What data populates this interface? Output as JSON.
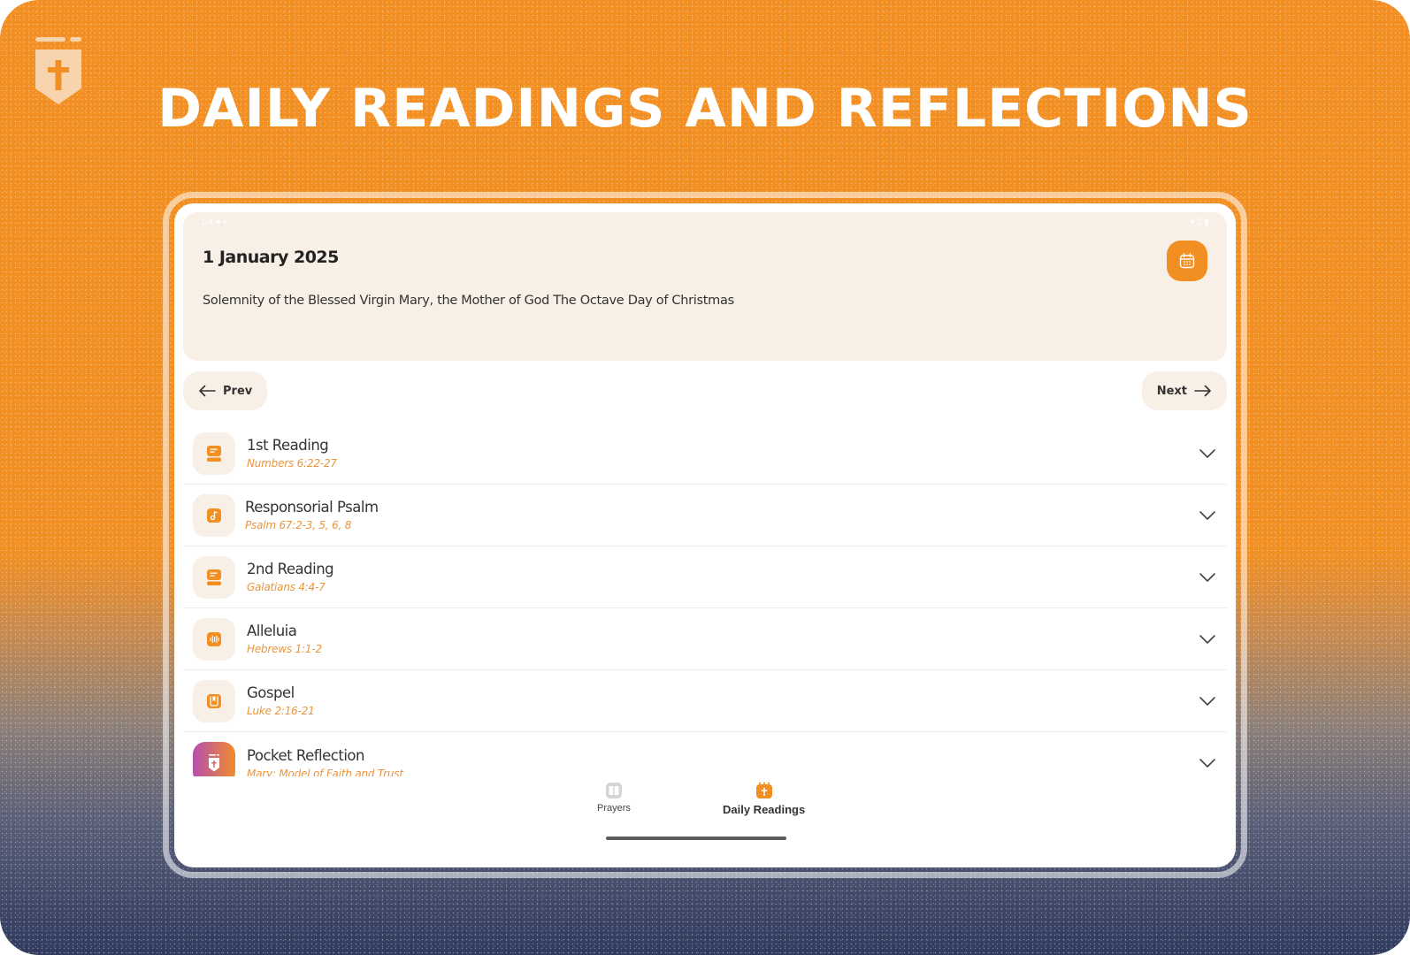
{
  "header": {
    "headline": "DAILY READINGS AND REFLECTIONS",
    "logo_icon": "shield-cross-icon"
  },
  "status_bar": {
    "left": "1:4 ● ▪",
    "right": "▾ 2 ▮"
  },
  "date_card": {
    "date": "1 January 2025",
    "feast": "Solemnity of the Blessed Virgin Mary, the Mother of God The Octave Day of Christmas",
    "calendar_icon": "calendar-icon"
  },
  "navigation": {
    "prev_label": "Prev",
    "next_label": "Next"
  },
  "readings": [
    {
      "title": "1st Reading",
      "reference": "Numbers 6:22-27",
      "icon": "book-text-icon"
    },
    {
      "title": "Responsorial Psalm",
      "reference": "Psalm  67:2-3, 5, 6, 8",
      "icon": "music-note-icon"
    },
    {
      "title": "2nd Reading",
      "reference": "Galatians 4:4-7",
      "icon": "book-text-icon"
    },
    {
      "title": "Alleluia",
      "reference": "Hebrews 1:1-2",
      "icon": "audio-wave-icon"
    },
    {
      "title": "Gospel",
      "reference": "Luke 2:16-21",
      "icon": "bookmark-book-icon"
    },
    {
      "title": "Pocket Reflection",
      "reference": "Mary: Model of Faith and Trust",
      "icon": "shield-cross-icon"
    }
  ],
  "bottom_nav": {
    "tabs": [
      {
        "label": "Prayers",
        "active": false
      },
      {
        "label": "Daily Readings",
        "active": true
      }
    ]
  },
  "colors": {
    "accent": "#f28f22",
    "card_bg": "#f8efe6",
    "reference_text": "#e9953c",
    "background_top": "#f38f22",
    "background_bottom": "#2f3a5e"
  }
}
